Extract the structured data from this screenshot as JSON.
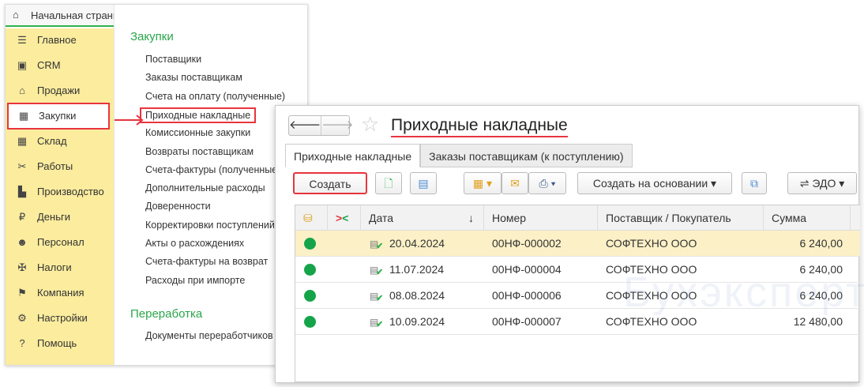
{
  "home_tab": "Начальная страница",
  "sidebar": {
    "items": [
      {
        "label": "Главное",
        "icon": "menu-icon"
      },
      {
        "label": "CRM",
        "icon": "crm-card-icon"
      },
      {
        "label": "Продажи",
        "icon": "basket-icon"
      },
      {
        "label": "Закупки",
        "icon": "cart-icon",
        "selected": true
      },
      {
        "label": "Склад",
        "icon": "warehouse-icon"
      },
      {
        "label": "Работы",
        "icon": "tools-icon"
      },
      {
        "label": "Производство",
        "icon": "factory-icon"
      },
      {
        "label": "Деньги",
        "icon": "ruble-icon"
      },
      {
        "label": "Персонал",
        "icon": "people-icon"
      },
      {
        "label": "Налоги",
        "icon": "eagle-icon"
      },
      {
        "label": "Компания",
        "icon": "flag-icon"
      },
      {
        "label": "Настройки",
        "icon": "gear-icon"
      },
      {
        "label": "Помощь",
        "icon": "help-icon"
      }
    ]
  },
  "menu": {
    "section1": "Закупки",
    "items1": [
      "Поставщики",
      "Заказы поставщикам",
      "Счета на оплату (полученные)",
      "Приходные накладные",
      "Комиссионные закупки",
      "Возвраты поставщикам",
      "Счета-фактуры (полученные)",
      "Дополнительные расходы",
      "Доверенности",
      "Корректировки поступлений",
      "Акты о расхождениях",
      "Счета-фактуры на возврат",
      "Расходы при импорте"
    ],
    "section2": "Переработка",
    "items2": [
      "Документы переработчиков"
    ]
  },
  "window": {
    "title": "Приходные накладные",
    "tabs": [
      "Приходные накладные",
      "Заказы поставщикам (к поступлению)"
    ],
    "toolbar": {
      "create": "Создать",
      "create_based": "Создать на основании",
      "edo": "ЭДО"
    },
    "columns": [
      "Дата",
      "Номер",
      "Поставщик / Покупатель",
      "Сумма"
    ],
    "sort_indicator": "↓",
    "rows": [
      {
        "date": "20.04.2024",
        "number": "00НФ-000002",
        "partner": "СОФТЕХНО ООО",
        "sum": "6 240,00"
      },
      {
        "date": "11.07.2024",
        "number": "00НФ-000004",
        "partner": "СОФТЕХНО ООО",
        "sum": "6 240,00"
      },
      {
        "date": "08.08.2024",
        "number": "00НФ-000006",
        "partner": "СОФТЕХНО ООО",
        "sum": "6 240,00"
      },
      {
        "date": "10.09.2024",
        "number": "00НФ-000007",
        "partner": "СОФТЕХНО ООО",
        "sum": "12 480,00"
      }
    ]
  },
  "watermark": "Бухэксперт",
  "colors": {
    "accent_green": "#2aa64a",
    "highlight_red": "#e8343e",
    "sidebar_yellow": "#fbec9e"
  }
}
